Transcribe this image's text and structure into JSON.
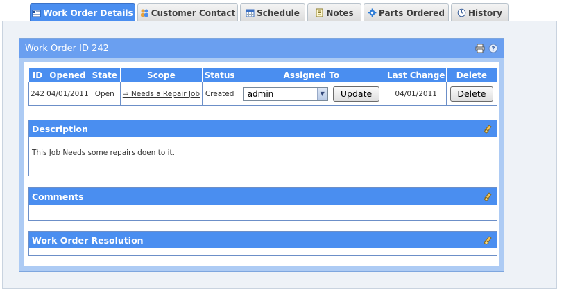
{
  "tabs": [
    {
      "label": "Work Order Details",
      "icon": "details-icon",
      "active": true
    },
    {
      "label": "Customer Contact",
      "icon": "contacts-icon",
      "active": false
    },
    {
      "label": "Schedule",
      "icon": "calendar-icon",
      "active": false
    },
    {
      "label": "Notes",
      "icon": "notes-icon",
      "active": false
    },
    {
      "label": "Parts Ordered",
      "icon": "gear-icon",
      "active": false
    },
    {
      "label": "History",
      "icon": "clock-icon",
      "active": false
    }
  ],
  "panel": {
    "title": "Work Order ID 242",
    "print_icon": "print-icon",
    "help_icon": "help-icon"
  },
  "table": {
    "headers": [
      "ID",
      "Opened",
      "State",
      "Scope",
      "Status",
      "Assigned To",
      "Last Change",
      "Delete"
    ],
    "row": {
      "id": "242",
      "opened": "04/01/2011",
      "state": "Open",
      "scope": "⇒ Needs a Repair Job",
      "status": "Created",
      "assigned": "admin",
      "update_label": "Update",
      "last_change": "04/01/2011",
      "delete_label": "Delete"
    }
  },
  "sections": {
    "description": {
      "title": "Description",
      "body": "This Job Needs some repairs doen to it."
    },
    "comments": {
      "title": "Comments",
      "body": ""
    },
    "resolution": {
      "title": "Work Order Resolution",
      "body": ""
    }
  },
  "colors": {
    "accent": "#4a8ef0",
    "panel_bg": "#adcbf4",
    "outer_bg": "#eef2f7"
  }
}
